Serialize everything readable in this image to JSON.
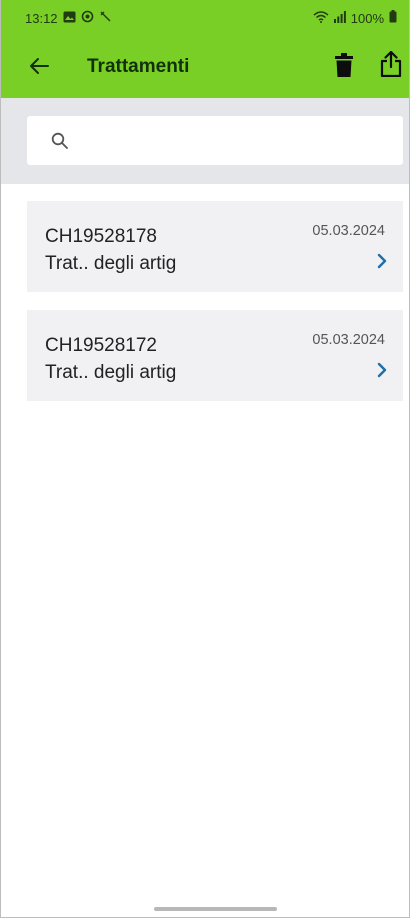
{
  "status_bar": {
    "time": "13:12",
    "battery": "100%"
  },
  "toolbar": {
    "title": "Trattamenti",
    "back_icon": "arrow-left-icon",
    "delete_icon": "trash-icon",
    "share_icon": "share-icon"
  },
  "search": {
    "placeholder": "",
    "value": "",
    "icon": "search-icon"
  },
  "items": [
    {
      "code": "CH19528178",
      "description": "Trat.. degli artig",
      "date": "05.03.2024"
    },
    {
      "code": "CH19528172",
      "description": "Trat.. degli artig",
      "date": "05.03.2024"
    }
  ],
  "colors": {
    "appbar": "#79cf25",
    "search_bg": "#e4e6e9",
    "card_bg": "#f1f1f3",
    "chevron": "#1f6fa8"
  }
}
